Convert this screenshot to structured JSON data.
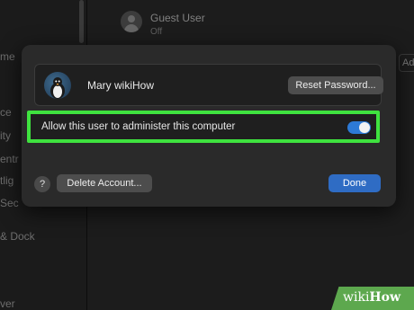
{
  "background": {
    "sidebar_items": [
      "me",
      "ce",
      "ity",
      "entr",
      "tlig",
      "Sec",
      "& Dock",
      "ver"
    ],
    "guest_user": {
      "name": "Guest User",
      "status": "Off"
    },
    "right_button": "Adv"
  },
  "sheet": {
    "user": {
      "name": "Mary wikiHow",
      "reset_password_label": "Reset Password..."
    },
    "admin_toggle": {
      "label": "Allow this user to administer this computer",
      "enabled": true
    },
    "help_label": "?",
    "delete_account_label": "Delete Account...",
    "done_label": "Done"
  },
  "watermark": {
    "prefix": "wiki",
    "suffix": "How"
  },
  "colors": {
    "accent": "#2d7ad6",
    "done_button": "#2f6cc4",
    "highlight": "#3fe23f"
  }
}
